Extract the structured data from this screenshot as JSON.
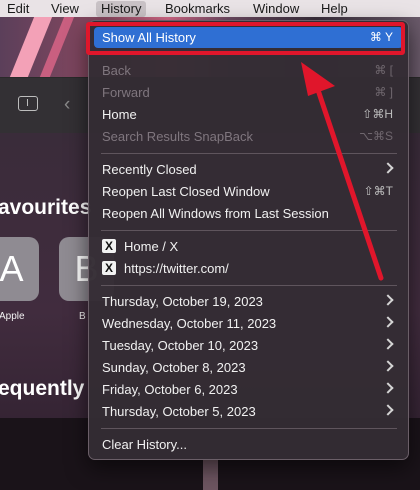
{
  "menubar": {
    "items": [
      "Edit",
      "View",
      "History",
      "Bookmarks",
      "Window",
      "Help"
    ],
    "active": "History"
  },
  "background": {
    "favourites_title": "avourites",
    "frequently_title": "equently",
    "tiles": [
      {
        "letter": "A",
        "label": "Apple"
      },
      {
        "letter": "B",
        "label": "B"
      }
    ]
  },
  "menu": {
    "show_all": {
      "label": "Show All History",
      "shortcut": "⌘ Y"
    },
    "nav": [
      {
        "label": "Back",
        "shortcut": "⌘ [",
        "enabled": false
      },
      {
        "label": "Forward",
        "shortcut": "⌘ ]",
        "enabled": false
      },
      {
        "label": "Home",
        "shortcut": "⇧⌘H",
        "enabled": true
      },
      {
        "label": "Search Results SnapBack",
        "shortcut": "⌥⌘S",
        "enabled": false
      }
    ],
    "recent": [
      {
        "label": "Recently Closed",
        "shortcut": ""
      },
      {
        "label": "Reopen Last Closed Window",
        "shortcut": "⇧⌘T"
      },
      {
        "label": "Reopen All Windows from Last Session",
        "shortcut": ""
      }
    ],
    "sites": [
      {
        "icon": "X",
        "label": "Home / X"
      },
      {
        "icon": "X",
        "label": "https://twitter.com/"
      }
    ],
    "days": [
      "Thursday, October 19, 2023",
      "Wednesday, October 11, 2023",
      "Tuesday, October 10, 2023",
      "Sunday, October 8, 2023",
      "Friday, October 6, 2023",
      "Thursday, October 5, 2023"
    ],
    "clear": "Clear History..."
  },
  "colors": {
    "highlight": "#2f6fd3",
    "annotation": "#e0162b"
  }
}
